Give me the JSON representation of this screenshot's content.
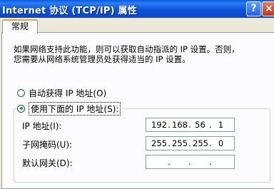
{
  "window": {
    "title": "Internet 协议 (TCP/IP) 属性",
    "help_glyph": "?",
    "close_glyph": "×"
  },
  "tabs": [
    {
      "label": "常规"
    }
  ],
  "description": {
    "line1": "如果网络支持此功能，则可以获取自动指派的 IP 设置。否则，",
    "line2": "您需要从网络系统管理员处获得适当的 IP 设置。"
  },
  "radios": {
    "auto": {
      "label": "自动获得 IP 地址(O)",
      "selected": false
    },
    "manual": {
      "label": "使用下面的 IP 地址(S):",
      "selected": true
    }
  },
  "fields": {
    "ip": {
      "label": "IP 地址(I):",
      "octets": [
        "192",
        "168",
        "56",
        "1"
      ]
    },
    "mask": {
      "label": "子网掩码(U):",
      "octets": [
        "255",
        "255",
        "255",
        "0"
      ]
    },
    "gateway": {
      "label": "默认网关(D):",
      "octets": [
        "",
        "",
        "",
        ""
      ]
    }
  },
  "colors": {
    "titlebar": "#0a54d8",
    "dialog_bg": "#ece9d8",
    "tab_accent": "#f2a234",
    "radio_selected": "#21a121"
  }
}
